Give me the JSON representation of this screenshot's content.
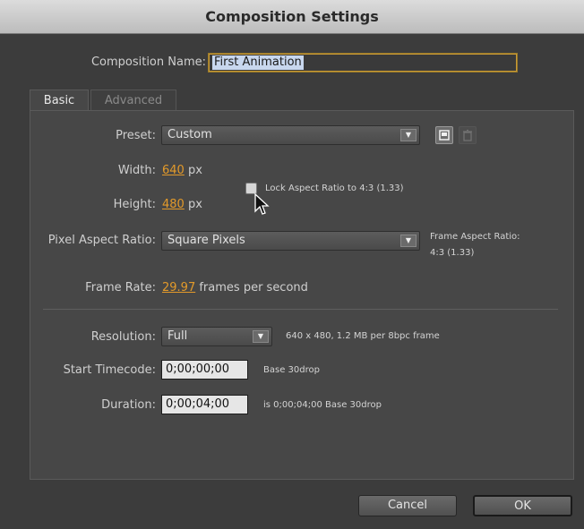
{
  "window": {
    "title": "Composition Settings"
  },
  "composition_name": {
    "label": "Composition Name:",
    "value": "First Animation"
  },
  "tabs": [
    {
      "label": "Basic",
      "active": true
    },
    {
      "label": "Advanced",
      "active": false
    }
  ],
  "preset": {
    "label": "Preset:",
    "value": "Custom"
  },
  "width": {
    "label": "Width:",
    "value": "640",
    "unit": "px"
  },
  "height": {
    "label": "Height:",
    "value": "480",
    "unit": "px"
  },
  "lock_aspect": {
    "label": "Lock Aspect Ratio to 4:3 (1.33)",
    "checked": false
  },
  "pixel_aspect": {
    "label": "Pixel Aspect Ratio:",
    "value": "Square Pixels",
    "frame_aspect_label": "Frame Aspect Ratio:",
    "frame_aspect_value": "4:3 (1.33)"
  },
  "frame_rate": {
    "label": "Frame Rate:",
    "value": "29.97",
    "unit": "frames per second"
  },
  "resolution": {
    "label": "Resolution:",
    "value": "Full",
    "info": "640 x 480, 1.2 MB per 8bpc frame"
  },
  "start_timecode": {
    "label": "Start Timecode:",
    "value": "0;00;00;00",
    "info": "Base 30drop"
  },
  "duration": {
    "label": "Duration:",
    "value": "0;00;04;00",
    "info": "is 0;00;04;00  Base 30drop"
  },
  "buttons": {
    "cancel": "Cancel",
    "ok": "OK"
  },
  "colors": {
    "accent": "#e39a2a",
    "panel": "#474747",
    "background": "#3c3c3c"
  },
  "icons": {
    "dropdown_arrow": "triangle-down",
    "save_preset": "save-preset-icon",
    "delete_preset": "trash-icon",
    "cursor": "mouse-pointer-icon"
  }
}
